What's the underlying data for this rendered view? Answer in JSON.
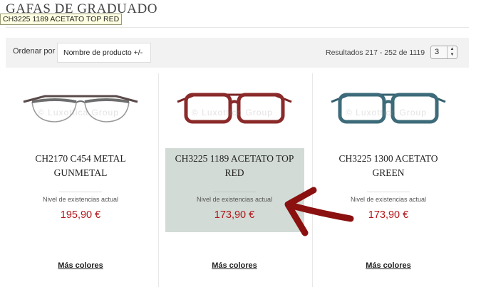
{
  "page": {
    "title": "GAFAS DE GRADUADO",
    "tooltip": "CH3225 1189 ACETATO TOP RED"
  },
  "toolbar": {
    "sort_label": "Ordenar por",
    "sort_value": "Nombre de producto +/-",
    "results_text": "Resultados 217 - 252 de 1119",
    "page_value": "3"
  },
  "products": [
    {
      "name_line1": "CH2170 C454 METAL",
      "name_line2": "GUNMETAL",
      "stock_label": "Nivel de existencias actual",
      "price": "195,90 €",
      "more_colors": "Más colores",
      "frame_color": "#6e6e6e",
      "temple_color": "#5a4a4a"
    },
    {
      "name_line1": "CH3225 1189 ACETATO TOP",
      "name_line2": "RED",
      "stock_label": "Nivel de existencias actual",
      "price": "173,90 €",
      "more_colors": "Más colores",
      "frame_color": "#8b2a2a",
      "temple_color": "#7a2424"
    },
    {
      "name_line1": "CH3225 1300 ACETATO",
      "name_line2": "GREEN",
      "stock_label": "Nivel de existencias actual",
      "price": "173,90 €",
      "more_colors": "Más colores",
      "frame_color": "#3d6b7a",
      "temple_color": "#35606e"
    }
  ],
  "colors": {
    "price": "#b4161b",
    "highlight": "#d2dbd6",
    "annotation_arrow": "#8b1010"
  }
}
